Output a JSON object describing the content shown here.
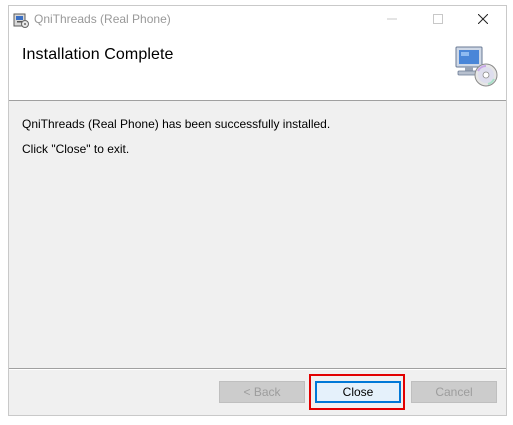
{
  "window": {
    "title": "QniThreads (Real Phone)",
    "icons": {
      "app": "installer-icon",
      "minimize": "minimize-icon",
      "maximize": "maximize-icon",
      "close": "close-icon"
    }
  },
  "header": {
    "title": "Installation Complete",
    "icon": "computer-cd-icon"
  },
  "body": {
    "message": "QniThreads (Real Phone) has been successfully installed.",
    "instruction": "Click \"Close\" to exit."
  },
  "buttons": {
    "back": "< Back",
    "close": "Close",
    "cancel": "Cancel"
  },
  "colors": {
    "highlight": "#e20000",
    "focus_accent": "#0078d7",
    "dialog_bg": "#f0f0f0"
  }
}
